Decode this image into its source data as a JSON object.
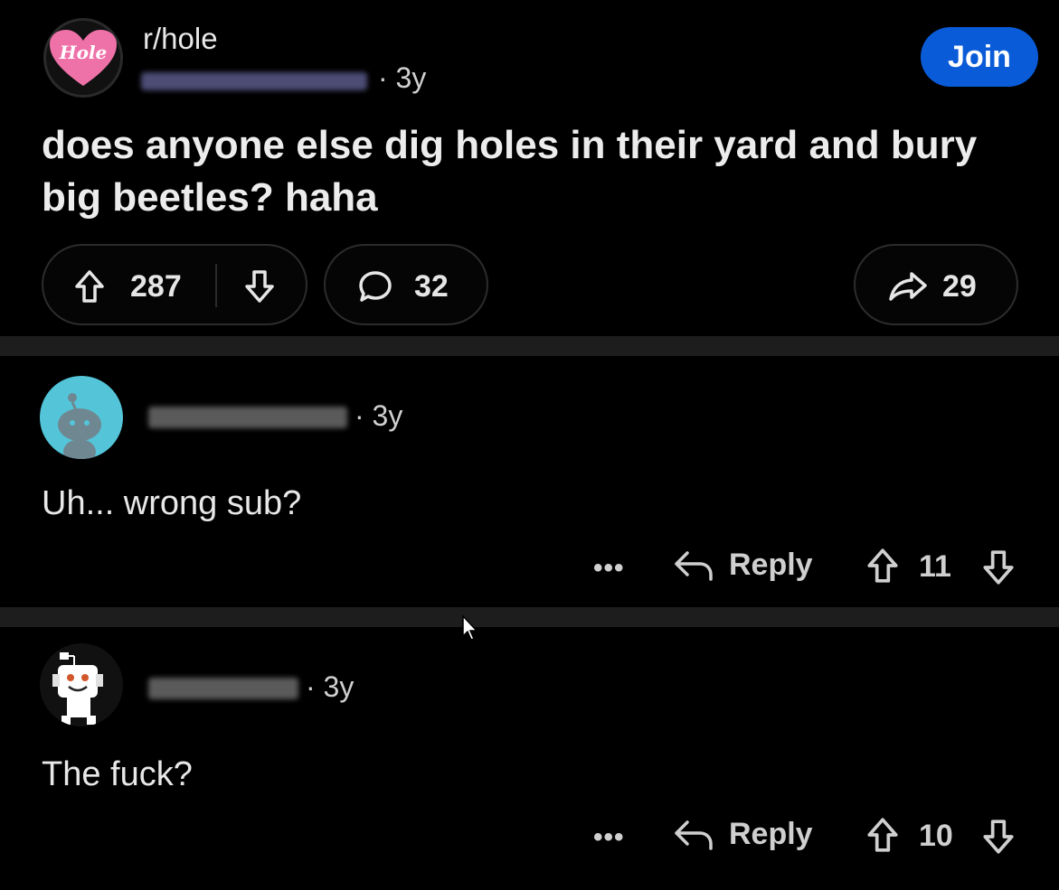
{
  "post": {
    "subreddit": "r/hole",
    "subreddit_logo_text": "Hole",
    "age": "· 3y",
    "join_label": "Join",
    "title": "does anyone else dig holes in their yard and bury big beetles? haha",
    "upvotes": "287",
    "comments": "32",
    "shares": "29"
  },
  "comments": [
    {
      "age": "· 3y",
      "text": "Uh... wrong sub?",
      "more": "•••",
      "reply_label": "Reply",
      "score": "11"
    },
    {
      "age": "· 3y",
      "text": "The fuck?",
      "more": "•••",
      "reply_label": "Reply",
      "score": "10"
    }
  ],
  "colors": {
    "background": "#000000",
    "join": "#0a5bd8",
    "logo_pink": "#ee72a8",
    "avatar_cyan": "#54c5d9"
  }
}
